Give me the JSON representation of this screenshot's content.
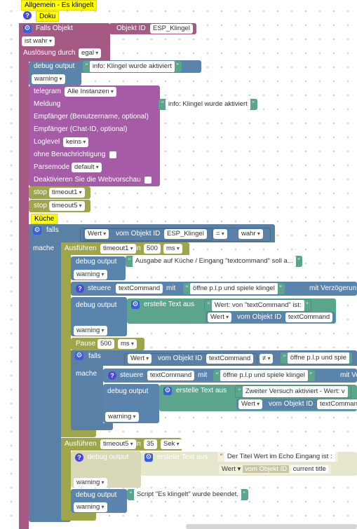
{
  "comments": {
    "top": "Allgemein - Es klingelt",
    "doku": "Doku",
    "kueche": "Küche"
  },
  "trigger": {
    "label": "Falls Objekt",
    "object_id_label": "Objekt ID",
    "object_id": "ESP_Klingel",
    "condition": "ist wahr",
    "ausloesung_label": "Auslösung durch",
    "ausloesung_value": "egal"
  },
  "debug1": {
    "label": "debug output",
    "text": "info: Klingel wurde aktiviert",
    "level": "warning"
  },
  "telegram": {
    "label": "telegram",
    "instance": "Alle Instanzen",
    "meldung_label": "Meldung",
    "meldung_text": "info: Klingel wurde aktiviert",
    "empf_user_label": "Empfänger (Benutzername, optional)",
    "empf_chat_label": "Empfänger (Chat-ID, optional)",
    "loglevel_label": "Loglevel",
    "loglevel_value": "keins",
    "ohne_label": "ohne Benachrichtigung",
    "parsemode_label": "Parsemode",
    "parsemode_value": "default",
    "deaktiv_label": "Deaktivieren Sie die Webvorschau"
  },
  "stops": {
    "label": "stop",
    "t1": "timeout1",
    "t5": "timeout5"
  },
  "if1": {
    "falls_label": "falls",
    "wert_label": "Wert",
    "vom_objekt_label": "vom Objekt ID",
    "object_id": "ESP_Klingel",
    "op": "=",
    "value": "wahr",
    "mache_label": "mache"
  },
  "timeout1": {
    "label": "Ausführen",
    "name": "timeout1",
    "in_label": "in",
    "value": "500",
    "unit": "ms"
  },
  "debug2": {
    "label": "debug output",
    "text": "Ausgabe auf Küche / Eingang \"textcommand\" soll a...",
    "level": "warning"
  },
  "steuere1": {
    "label": "steuere",
    "target": "textCommand",
    "mit_label": "mit",
    "text": "öffne p.l.p und spiele klingel",
    "verz_label": "mit Verzögerun"
  },
  "debug3": {
    "label": "debug output",
    "create_label": "erstelle Text aus",
    "text": "Wert: von \"textCommand\" ist:",
    "wert_label": "Wert",
    "vom_objekt_label": "vom Objekt ID",
    "object_id": "textCommand",
    "level": "warning"
  },
  "pause": {
    "label": "Pause",
    "value": "500",
    "unit": "ms"
  },
  "if2": {
    "falls_label": "falls",
    "wert_label": "Wert",
    "vom_objekt_label": "vom Objekt ID",
    "object_id": "textCommand",
    "op": "≠",
    "text": "öffne p.l.p und spie",
    "mache_label": "mache"
  },
  "steuere2": {
    "label": "steuere",
    "target": "textCommand",
    "mit_label": "mit",
    "text": "öffne p.l.p und spiele klingel",
    "verz_label": "mit Ve"
  },
  "debug4": {
    "label": "debug output",
    "create_label": "erstelle Text aus",
    "text": "Zweiter Versuch aktiviert - Wert: v",
    "wert_label": "Wert",
    "vom_objekt_label": "vom Objekt ID",
    "object_id": "textComman",
    "level": "warning"
  },
  "timeout5": {
    "label": "Ausführen",
    "name": "timeout5",
    "in_label": "in",
    "value": "35",
    "unit": "Sek"
  },
  "debug5": {
    "label": "debug output",
    "create_label": "erstelle Text aus",
    "text": "Der Titel Wert im Echo Eingang ist :",
    "wert_label": "Wert",
    "vom_objekt_label": "vom Objekt ID",
    "object_id": "current title",
    "level": "warning"
  },
  "debug6": {
    "label": "debug output",
    "text": "Script \"Es klingelt\" wurde beendet.",
    "level": "warning"
  },
  "icons": {
    "help": "?",
    "gear": "⚙",
    "quote_open": "“",
    "quote_close": "”"
  }
}
